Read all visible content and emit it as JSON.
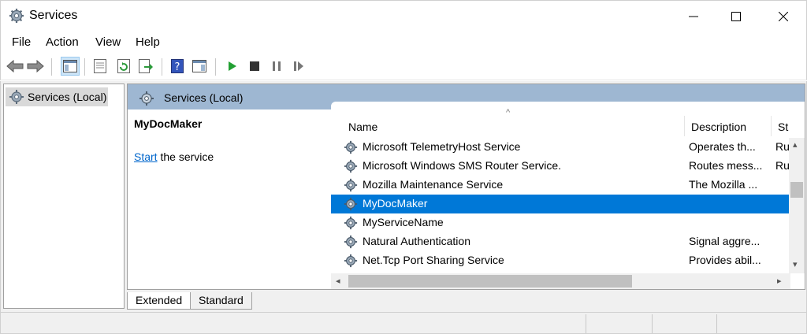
{
  "window": {
    "title": "Services"
  },
  "menu": [
    "File",
    "Action",
    "View",
    "Help"
  ],
  "tree": {
    "root_label": "Services (Local)"
  },
  "detail": {
    "header_label": "Services (Local)",
    "selected_title": "MyDocMaker",
    "action_link": "Start",
    "action_rest": " the service"
  },
  "columns": [
    "Name",
    "Description",
    "St"
  ],
  "rows": [
    {
      "name": "Microsoft TelemetryHost Service",
      "description": "Operates th...",
      "status": "Ru"
    },
    {
      "name": "Microsoft Windows SMS Router Service.",
      "description": "Routes mess...",
      "status": "Ru"
    },
    {
      "name": "Mozilla Maintenance Service",
      "description": "The Mozilla ...",
      "status": ""
    },
    {
      "name": "MyDocMaker",
      "description": "",
      "status": ""
    },
    {
      "name": "MyServiceName",
      "description": "",
      "status": ""
    },
    {
      "name": "Natural Authentication",
      "description": "Signal aggre...",
      "status": ""
    },
    {
      "name": "Net.Tcp Port Sharing Service",
      "description": "Provides abil...",
      "status": ""
    }
  ],
  "tabs": [
    "Extended",
    "Standard"
  ],
  "colors": {
    "selection": "#0078d7",
    "header_bar": "#9eb7d2",
    "link": "#0066cc"
  }
}
